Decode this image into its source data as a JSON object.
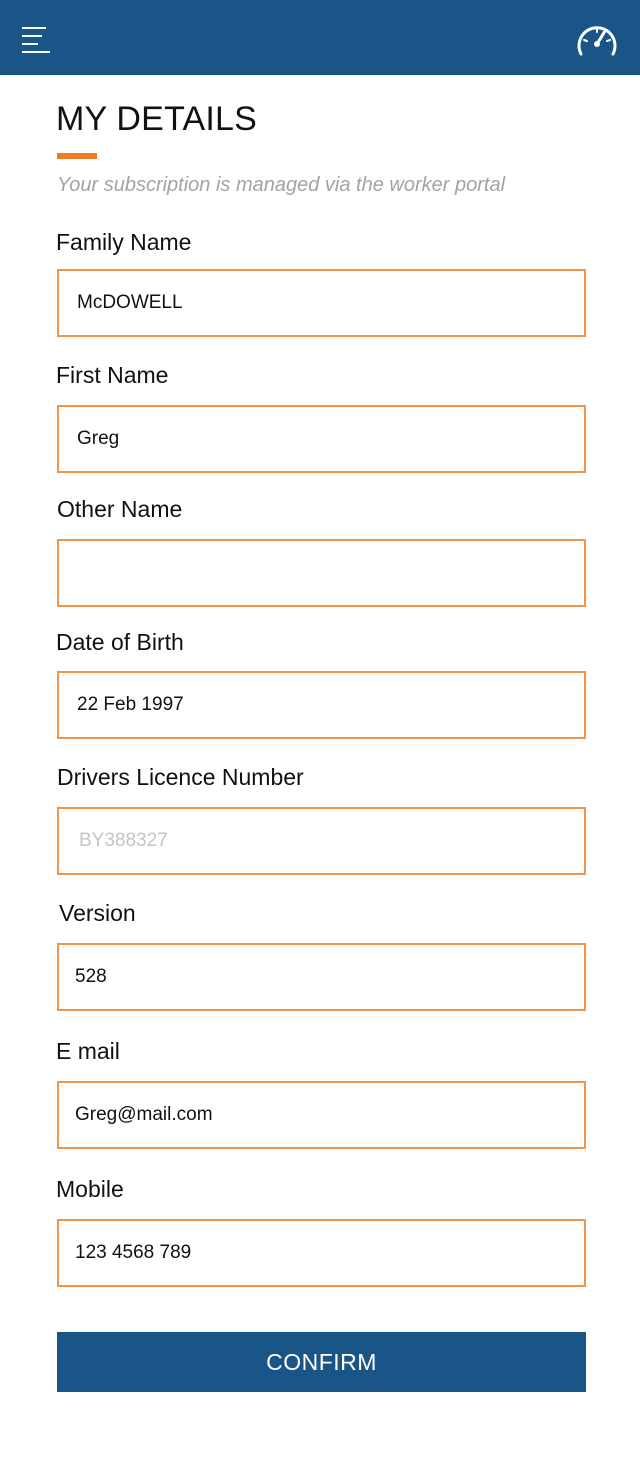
{
  "header": {
    "menu_icon": "hamburger-menu-icon",
    "dashboard_icon": "speedometer-icon",
    "bar_color": "#1a5587"
  },
  "page": {
    "title": "MY DETAILS",
    "subtitle": "Your subscription is managed via the worker portal",
    "accent_color": "#f07b26"
  },
  "form": {
    "family_name": {
      "label": "Family Name",
      "value": "McDOWELL",
      "placeholder": ""
    },
    "first_name": {
      "label": "First Name",
      "value": "Greg",
      "placeholder": ""
    },
    "other_name": {
      "label": "Other Name",
      "value": "",
      "placeholder": ""
    },
    "date_of_birth": {
      "label": "Date of Birth",
      "value": "22 Feb 1997",
      "placeholder": ""
    },
    "licence_number": {
      "label": "Drivers Licence Number",
      "value": "",
      "placeholder": "BY388327"
    },
    "version": {
      "label": "Version",
      "value": "528",
      "placeholder": ""
    },
    "email": {
      "label": "E mail",
      "value": "Greg@mail.com",
      "placeholder": ""
    },
    "mobile": {
      "label": "Mobile",
      "value": "123 4568 789",
      "placeholder": ""
    }
  },
  "actions": {
    "confirm_label": "CONFIRM"
  }
}
